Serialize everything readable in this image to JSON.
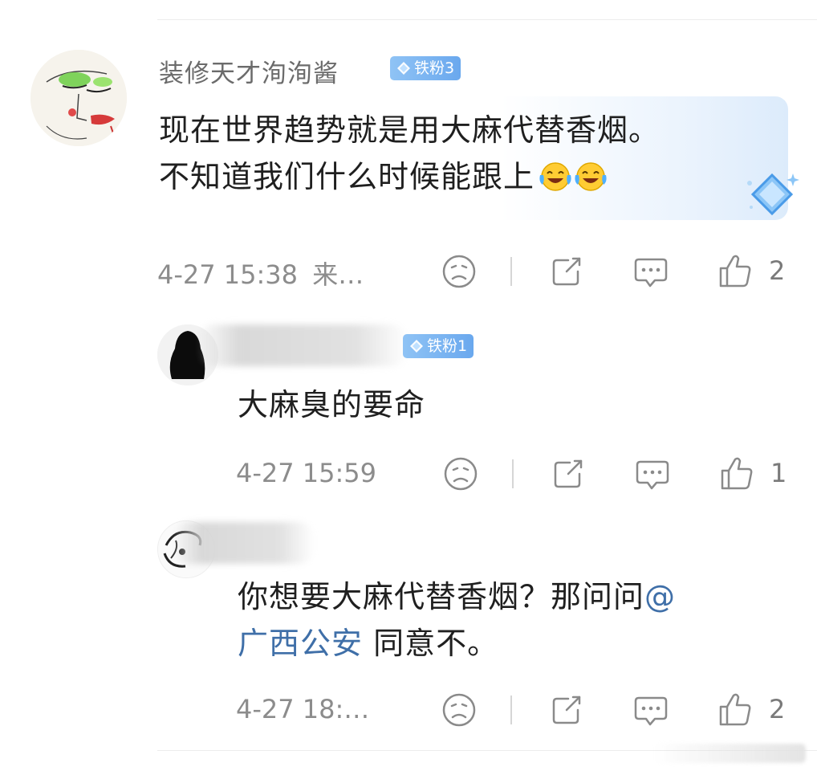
{
  "comments": [
    {
      "username": "装修天才洵洵酱",
      "badge": "铁粉3",
      "text_line1": "现在世界趋势就是用大麻代替香烟。",
      "text_line2": "不知道我们什么时候能跟上",
      "emoji": [
        "laughing-crying-emoji",
        "laughing-crying-emoji"
      ],
      "timestamp": "4-27 15:38",
      "source": "来…",
      "likes": "2"
    },
    {
      "username": "",
      "badge": "铁粉1",
      "text": "大麻臭的要命",
      "timestamp": "4-27 15:59",
      "likes": "1"
    },
    {
      "username": "",
      "text_prefix": "你想要大麻代替香烟？那问问",
      "mention_at": "@",
      "mention_name": "广西公安",
      "text_suffix": " 同意不。",
      "timestamp": "4-27 18:…",
      "likes": "2"
    }
  ],
  "colors": {
    "badge": "#6aa8ee",
    "mention": "#3f6fa8",
    "meta": "#8c8c8c",
    "icon": "#8a8a8a"
  }
}
